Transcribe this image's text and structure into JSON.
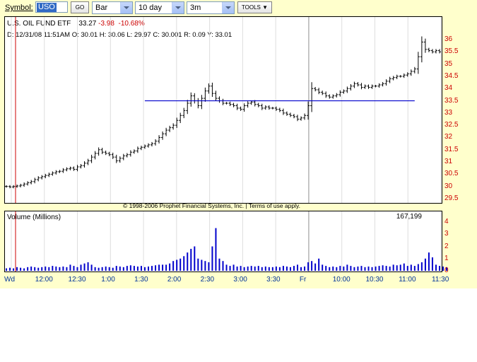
{
  "toolbar": {
    "symbol_label": "Symbol:",
    "symbol_value": "USO",
    "go_label": "GO",
    "chart_type": "Bar",
    "range": "10 day",
    "interval": "3m",
    "tools_label": "TOOLS"
  },
  "header": {
    "name": "U.S. OIL FUND ETF",
    "last": "33.27",
    "change": "-3.98",
    "change_pct": "-10.68%",
    "detail": "D: 12/31/08 11:51AM  O: 30.01  H: 30.06  L: 29.97  C: 30.001  R: 0.09  Y: 33.01"
  },
  "copyright": "© 1998-2006 Prophet Financial Systems, Inc. | Terms of use apply.",
  "volume_panel": {
    "title": "Volume (Millions)",
    "current": "167,199"
  },
  "colors": {
    "background": "#ffffcc",
    "price_bar": "#000000",
    "volume_bar": "#0000cc",
    "trendline": "#0000cc",
    "cursor": "#cc0000",
    "axis_label": "#cc0000",
    "time_label": "#003399"
  },
  "chart_data": [
    {
      "type": "bar",
      "subtype": "ohlc",
      "ylim": [
        29.5,
        36
      ],
      "yticks": [
        "36",
        "35.5",
        "35",
        "34.5",
        "34",
        "33.5",
        "33",
        "32.5",
        "32",
        "31.5",
        "31",
        "30.5",
        "30",
        "29.5"
      ],
      "xticks": [
        "Wd",
        "12:00",
        "12:30",
        "1:00",
        "1:30",
        "2:00",
        "2:30",
        "3:00",
        "3:30",
        "Fr",
        "10:00",
        "10:30",
        "11:00",
        "11:30"
      ],
      "closes": [
        30.0,
        29.98,
        30.0,
        30.02,
        30.05,
        30.1,
        30.15,
        30.2,
        30.28,
        30.35,
        30.4,
        30.45,
        30.5,
        30.55,
        30.6,
        30.62,
        30.68,
        30.72,
        30.75,
        30.7,
        30.8,
        30.85,
        30.95,
        31.05,
        31.2,
        31.35,
        31.5,
        31.4,
        31.35,
        31.3,
        31.2,
        31.05,
        31.15,
        31.25,
        31.3,
        31.4,
        31.45,
        31.55,
        31.6,
        31.65,
        31.7,
        31.75,
        31.85,
        32.0,
        32.15,
        32.3,
        32.4,
        32.5,
        32.7,
        32.9,
        33.1,
        33.4,
        33.7,
        33.5,
        33.3,
        33.6,
        33.9,
        34.1,
        33.8,
        33.6,
        33.5,
        33.4,
        33.4,
        33.35,
        33.3,
        33.2,
        33.15,
        33.3,
        33.4,
        33.45,
        33.35,
        33.3,
        33.2,
        33.25,
        33.2,
        33.2,
        33.15,
        33.1,
        33.0,
        32.95,
        32.9,
        32.85,
        32.75,
        32.8,
        32.9,
        33.3,
        34.0,
        33.95,
        33.85,
        33.8,
        33.7,
        33.65,
        33.7,
        33.75,
        33.85,
        33.9,
        34.0,
        34.1,
        34.2,
        34.15,
        34.05,
        34.1,
        34.05,
        34.1,
        34.1,
        34.15,
        34.2,
        34.3,
        34.4,
        34.45,
        34.5,
        34.5,
        34.55,
        34.6,
        34.7,
        34.8,
        35.3,
        35.9,
        35.6,
        35.55,
        35.5,
        35.55,
        35.5
      ],
      "trendline": {
        "from_bar": 39,
        "to_bar": 115,
        "y": 33.5
      }
    },
    {
      "type": "bar",
      "title": "Volume (Millions)",
      "ylim": [
        0,
        4
      ],
      "yticks": [
        "4",
        "3",
        "2",
        "1",
        "0"
      ],
      "values": [
        0.2,
        0.25,
        0.2,
        0.3,
        0.25,
        0.2,
        0.3,
        0.35,
        0.3,
        0.25,
        0.3,
        0.35,
        0.3,
        0.4,
        0.35,
        0.3,
        0.35,
        0.3,
        0.5,
        0.4,
        0.3,
        0.5,
        0.6,
        0.7,
        0.5,
        0.3,
        0.25,
        0.3,
        0.35,
        0.3,
        0.25,
        0.4,
        0.35,
        0.3,
        0.4,
        0.45,
        0.4,
        0.35,
        0.4,
        0.3,
        0.35,
        0.4,
        0.45,
        0.5,
        0.5,
        0.5,
        0.6,
        0.8,
        0.9,
        1.0,
        1.2,
        1.5,
        1.8,
        2.0,
        1.0,
        0.9,
        0.8,
        0.7,
        2.0,
        3.5,
        1.0,
        0.8,
        0.5,
        0.4,
        0.5,
        0.35,
        0.4,
        0.3,
        0.35,
        0.4,
        0.35,
        0.4,
        0.3,
        0.35,
        0.3,
        0.3,
        0.35,
        0.3,
        0.4,
        0.35,
        0.3,
        0.4,
        0.5,
        0.3,
        0.35,
        0.7,
        0.8,
        0.6,
        1.0,
        0.5,
        0.4,
        0.3,
        0.35,
        0.3,
        0.4,
        0.35,
        0.5,
        0.4,
        0.3,
        0.35,
        0.4,
        0.3,
        0.35,
        0.3,
        0.35,
        0.4,
        0.45,
        0.4,
        0.35,
        0.5,
        0.45,
        0.5,
        0.6,
        0.4,
        0.5,
        0.4,
        0.55,
        0.7,
        1.0,
        1.5,
        1.1,
        0.5,
        0.4,
        0.35,
        0.3
      ]
    }
  ]
}
